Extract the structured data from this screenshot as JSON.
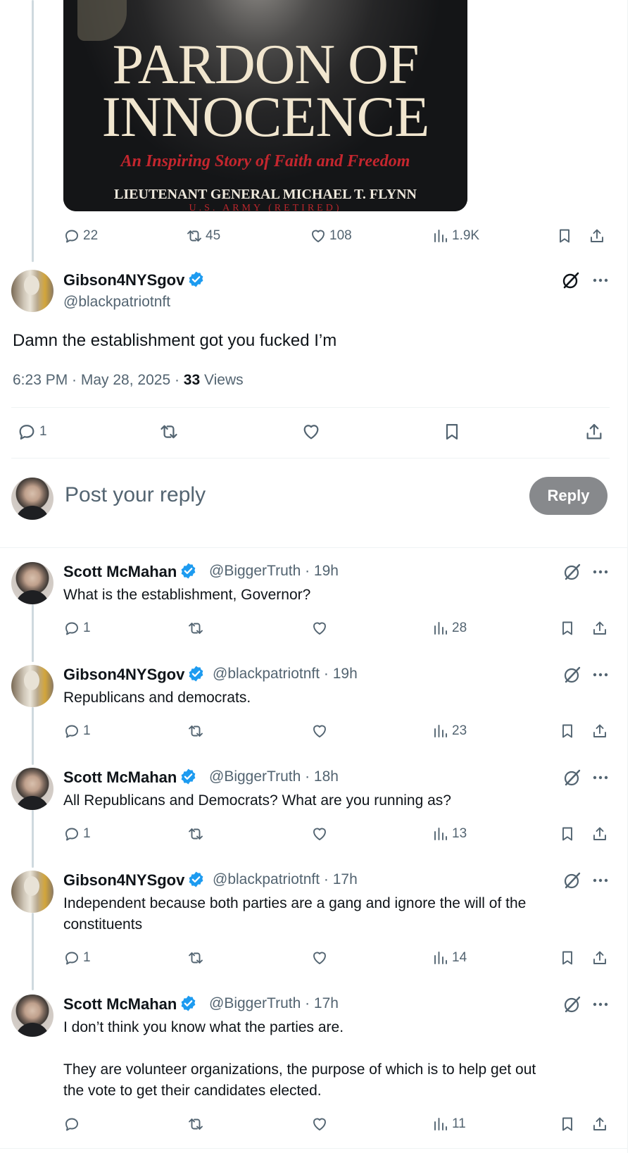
{
  "quoted_post": {
    "image": {
      "title_line1": "PARDON OF",
      "title_line2": "INNOCENCE",
      "subtitle": "An Inspiring Story of Faith and Freedom",
      "author": "LIEUTENANT GENERAL MICHAEL T. FLYNN",
      "rank_note": "U.S. ARMY (RETIRED)"
    },
    "stats": {
      "replies": "22",
      "reposts": "45",
      "likes": "108",
      "views": "1.9K"
    }
  },
  "main_post": {
    "author_name": "Gibson4NYSgov",
    "author_handle": "@blackpatriotnft",
    "text": "Damn the establishment got you fucked I’m",
    "time": "6:23 PM · May 28, 2025 · ",
    "views_count": "33",
    "views_label": " Views",
    "stats": {
      "replies": "1"
    }
  },
  "reply_composer": {
    "placeholder": "Post your reply",
    "button_label": "Reply"
  },
  "replies": [
    {
      "name": "Scott McMahan",
      "handle": "@BiggerTruth · 19h",
      "text": "What is the establishment, Governor?",
      "replies": "1",
      "views": "28"
    },
    {
      "name": "Gibson4NYSgov",
      "handle": "@blackpatriotnft · 19h",
      "text": "Republicans and democrats.",
      "replies": "1",
      "views": "23"
    },
    {
      "name": "Scott McMahan",
      "handle": "@BiggerTruth · 18h",
      "text": "All Republicans and Democrats? What are you running as?",
      "replies": "1",
      "views": "13"
    },
    {
      "name": "Gibson4NYSgov",
      "handle": "@blackpatriotnft · 17h",
      "text_line1": "Independent because both parties are a gang and ignore the will of the",
      "text_line2": "constituents",
      "replies": "1",
      "views": "14"
    },
    {
      "name": "Scott McMahan",
      "handle": "@BiggerTruth · 17h",
      "text_line1": "I don’t think you know what the parties are.",
      "text_line2": "They are volunteer organizations, the purpose of which is to help get out",
      "text_line3": "the vote to get their candidates elected.",
      "replies": "",
      "views": "11"
    }
  ],
  "colors": {
    "verified_blue": "#1d9bf0",
    "secondary_text": "#536471",
    "reply_button_bg": "#87898c"
  },
  "icons": [
    "reply-icon",
    "repost-icon",
    "like-icon",
    "views-icon",
    "bookmark-icon",
    "share-icon",
    "grok-icon",
    "more-icon",
    "verified-icon"
  ]
}
